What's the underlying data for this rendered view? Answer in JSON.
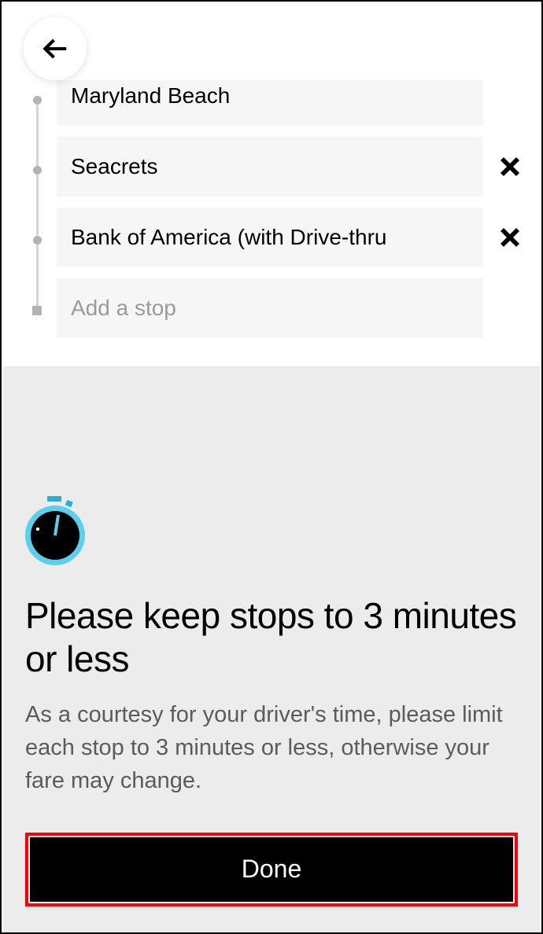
{
  "stops": {
    "items": [
      {
        "label": "Maryland Beach",
        "removable": false
      },
      {
        "label": "Seacrets",
        "removable": true
      },
      {
        "label": "Bank of America (with Drive-thru",
        "removable": true
      }
    ],
    "add_placeholder": "Add a stop"
  },
  "info": {
    "headline": "Please keep stops to 3 minutes or less",
    "subtext": "As a courtesy for your driver's time, please limit each stop to 3 minutes or less, otherwise your fare may change.",
    "done_label": "Done"
  }
}
